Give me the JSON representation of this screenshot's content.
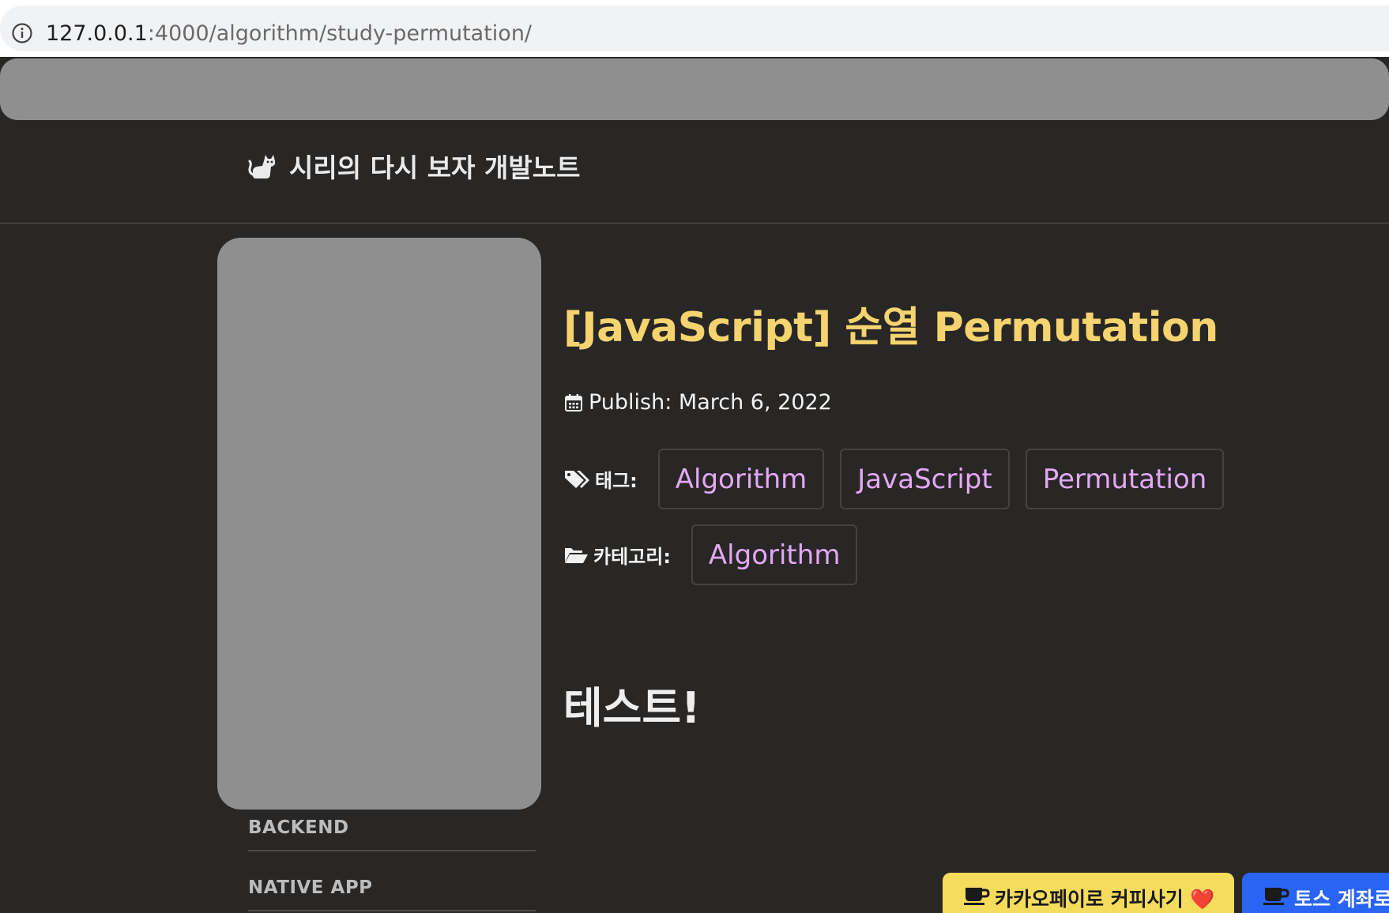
{
  "browser": {
    "url_host": "127.0.0.1",
    "url_rest": ":4000/algorithm/study-permutation/"
  },
  "header": {
    "site_title": "시리의 다시 보자 개발노트",
    "logo_icon": "cat-icon"
  },
  "sidebar": {
    "items": [
      {
        "label": "BACKEND"
      },
      {
        "label": "NATIVE APP"
      }
    ]
  },
  "post": {
    "title": "[JavaScript] 순열 Permutation",
    "publish": "Publish: March 6, 2022",
    "tags_label": "태그:",
    "tags": [
      "Algorithm",
      "JavaScript",
      "Permutation"
    ],
    "category_label": "카테고리:",
    "categories": [
      "Algorithm"
    ],
    "content_heading": "테스트!"
  },
  "support": {
    "kakao_label": "카카오페이로 커피사기 ❤️",
    "toss_label": "토스 계좌로"
  },
  "colors": {
    "background": "#282726",
    "title": "#f5d36e",
    "chip_text": "#e4a8f5",
    "kakao": "#f6dc5c",
    "toss": "#2a64f5"
  }
}
